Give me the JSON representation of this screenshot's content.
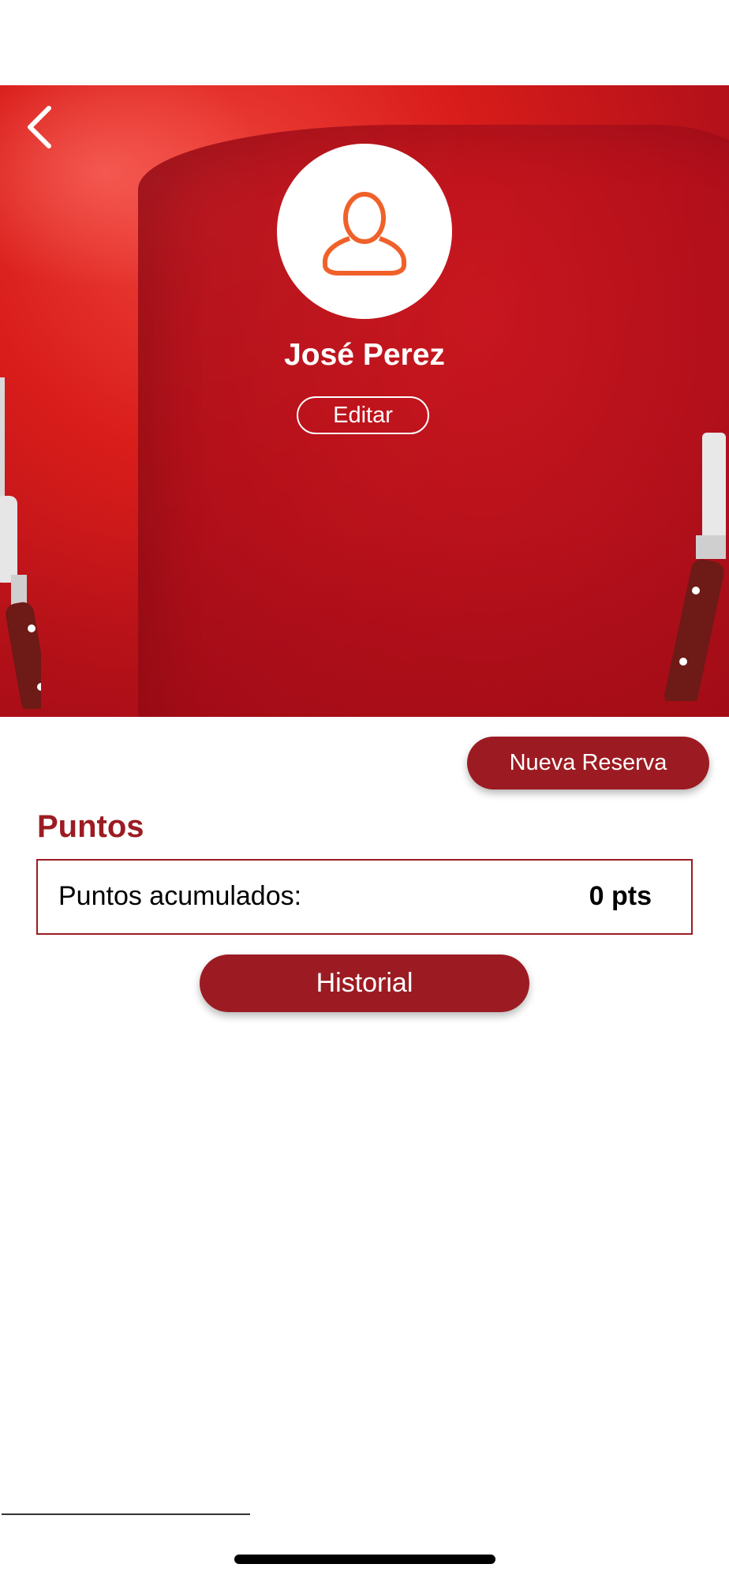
{
  "profile": {
    "name": "José Perez",
    "edit_label": "Editar"
  },
  "actions": {
    "new_reservation_label": "Nueva Reserva",
    "history_label": "Historial"
  },
  "points": {
    "title": "Puntos",
    "label": "Puntos acumulados:",
    "value": "0 pts"
  },
  "icons": {
    "back": "chevron-left-icon",
    "avatar": "user-icon"
  },
  "colors": {
    "primary": "#9c1b22",
    "avatar_icon": "#f0612a",
    "hero_red": "#c8141e"
  }
}
